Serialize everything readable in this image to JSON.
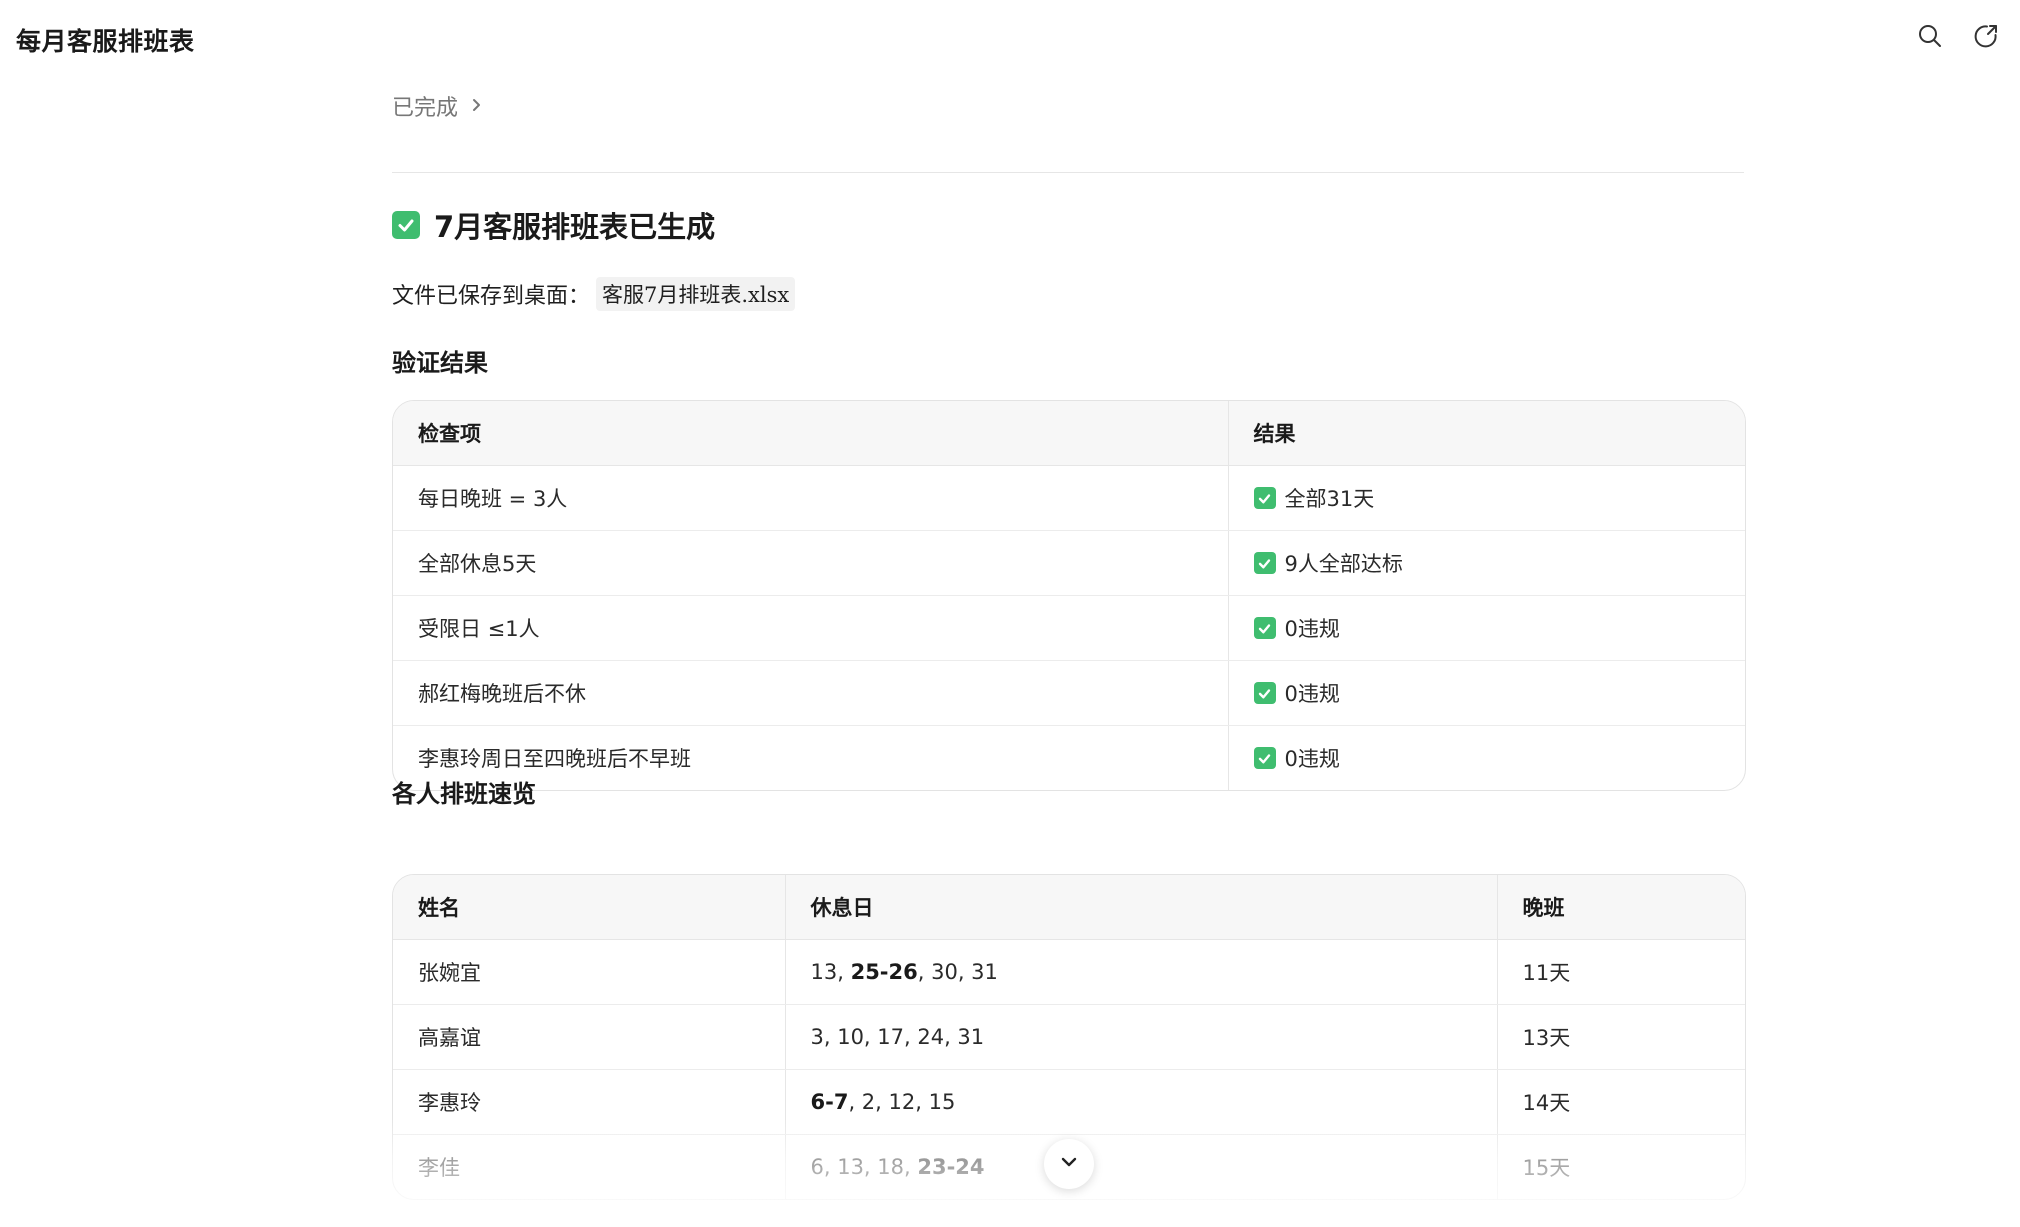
{
  "app": {
    "title": "每月客服排班表"
  },
  "status": {
    "label": "已完成"
  },
  "heading": {
    "text": "7月客服排班表已生成"
  },
  "file": {
    "prefix": "文件已保存到桌面：",
    "name": "客服7月排班表.xlsx"
  },
  "verification": {
    "title": "验证结果",
    "headers": [
      "检查项",
      "结果"
    ],
    "rows": [
      {
        "item": "每日晚班 = 3人",
        "result": "全部31天"
      },
      {
        "item": "全部休息5天",
        "result": "9人全部达标"
      },
      {
        "item": "受限日 ≤1人",
        "result": "0违规"
      },
      {
        "item": "郝红梅晚班后不休",
        "result": "0违规"
      },
      {
        "item": "李惠玲周日至四晚班后不早班",
        "result": "0违规"
      }
    ]
  },
  "overview": {
    "title": "各人排班速览",
    "headers": [
      "姓名",
      "休息日",
      "晚班"
    ],
    "rows": [
      {
        "name": "张婉宜",
        "rest_parts": [
          {
            "t": "13, "
          },
          {
            "t": "25-26",
            "b": true
          },
          {
            "t": ", 30, 31"
          }
        ],
        "night": "11天"
      },
      {
        "name": "高嘉谊",
        "rest_parts": [
          {
            "t": "3, 10, 17, 24, 31"
          }
        ],
        "night": "13天"
      },
      {
        "name": "李惠玲",
        "rest_parts": [
          {
            "t": "6-7",
            "b": true
          },
          {
            "t": ", 2, 12, 15"
          }
        ],
        "night": "14天"
      },
      {
        "name": "李佳",
        "rest_parts": [
          {
            "t": "6, 13, 18, "
          },
          {
            "t": "23-24",
            "b": true
          }
        ],
        "night": "15天"
      }
    ]
  },
  "icons": {
    "search": "search-icon",
    "share": "share-icon",
    "check": "check-icon",
    "chevron_right": "chevron-right-icon",
    "chevron_down": "chevron-down-icon"
  },
  "colors": {
    "check_green": "#3fbd6f"
  }
}
